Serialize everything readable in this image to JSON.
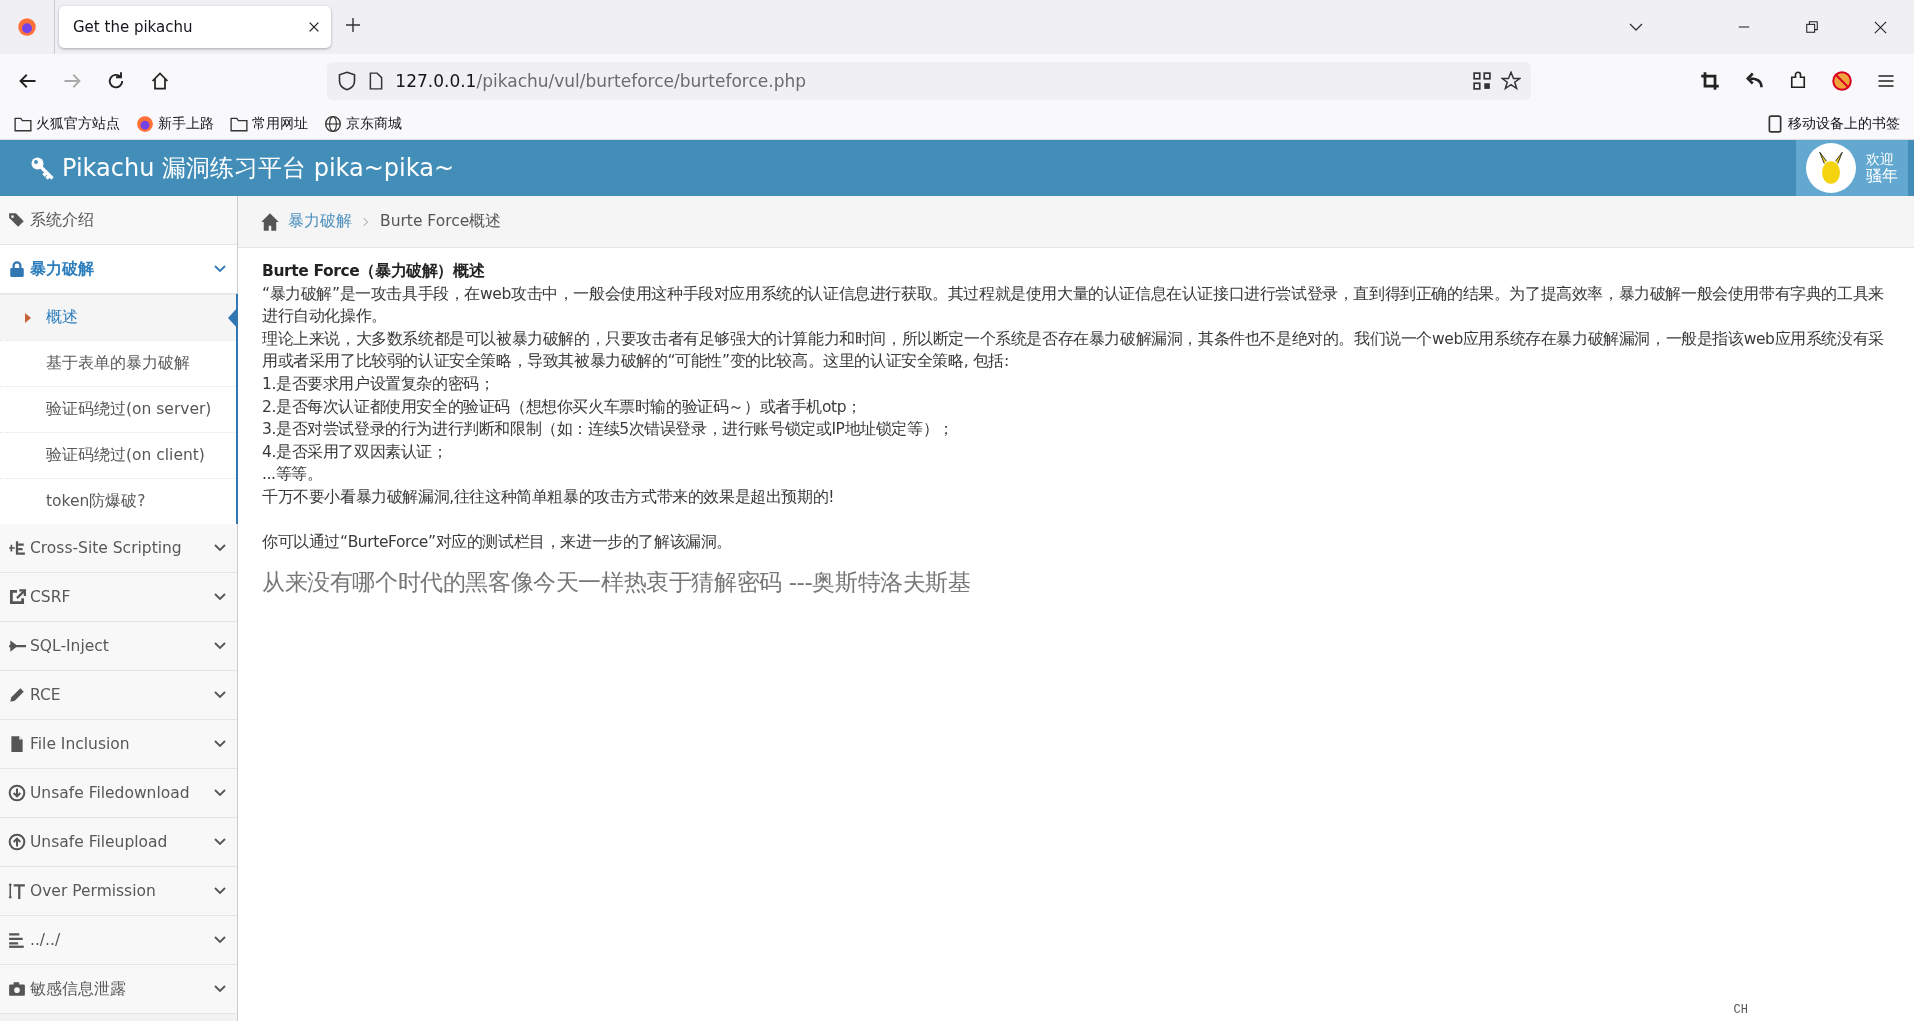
{
  "browser": {
    "tab_title": "Get the pikachu",
    "url_host": "127.0.0.1",
    "url_path": "/pikachu/vul/burteforce/burteforce.php",
    "bookmarks": [
      {
        "label": "火狐官方站点",
        "kind": "folder"
      },
      {
        "label": "新手上路",
        "kind": "firefox"
      },
      {
        "label": "常用网址",
        "kind": "folder"
      },
      {
        "label": "京东商城",
        "kind": "globe"
      }
    ],
    "mobile_bookmarks": "移动设备上的书签"
  },
  "header": {
    "title": "Pikachu 漏洞练习平台 pika~pika~",
    "welcome": "欢迎",
    "user": "骚年"
  },
  "sidebar": {
    "items": [
      {
        "label": "系统介绍",
        "kind": "link"
      },
      {
        "label": "暴力破解",
        "kind": "group",
        "expanded": true,
        "children": [
          {
            "label": "概述",
            "selected": true
          },
          {
            "label": "基于表单的暴力破解",
            "selected": false
          },
          {
            "label": "验证码绕过(on server)",
            "selected": false
          },
          {
            "label": "验证码绕过(on client)",
            "selected": false
          },
          {
            "label": "token防爆破?",
            "selected": false
          }
        ]
      },
      {
        "label": "Cross-Site Scripting",
        "kind": "group",
        "expanded": false
      },
      {
        "label": "CSRF",
        "kind": "group",
        "expanded": false
      },
      {
        "label": "SQL-Inject",
        "kind": "group",
        "expanded": false
      },
      {
        "label": "RCE",
        "kind": "group",
        "expanded": false
      },
      {
        "label": "File Inclusion",
        "kind": "group",
        "expanded": false
      },
      {
        "label": "Unsafe Filedownload",
        "kind": "group",
        "expanded": false
      },
      {
        "label": "Unsafe Fileupload",
        "kind": "group",
        "expanded": false
      },
      {
        "label": "Over Permission",
        "kind": "group",
        "expanded": false
      },
      {
        "label": "../../",
        "kind": "group",
        "expanded": false
      },
      {
        "label": "敏感信息泄露",
        "kind": "group",
        "expanded": false
      }
    ]
  },
  "breadcrumb": {
    "link": "暴力破解",
    "current": "Burte Force概述"
  },
  "content": {
    "heading": "Burte Force（暴力破解）概述",
    "lines": [
      "“暴力破解”是一攻击具手段，在web攻击中，一般会使用这种手段对应用系统的认证信息进行获取。其过程就是使用大量的认证信息在认证接口进行尝试登录，直到得到正确的结果。为了提高效率，暴力破解一般会使用带有字典的工具来进行自动化操作。",
      "理论上来说，大多数系统都是可以被暴力破解的，只要攻击者有足够强大的计算能力和时间，所以断定一个系统是否存在暴力破解漏洞，其条件也不是绝对的。我们说一个web应用系统存在暴力破解漏洞，一般是指该web应用系统没有采用或者采用了比较弱的认证安全策略，导致其被暴力破解的“可能性”变的比较高。这里的认证安全策略, 包括:",
      "1.是否要求用户设置复杂的密码；",
      "2.是否每次认证都使用安全的验证码（想想你买火车票时输的验证码～）或者手机otp；",
      "3.是否对尝试登录的行为进行判断和限制（如：连续5次错误登录，进行账号锁定或IP地址锁定等）；",
      "4.是否采用了双因素认证；",
      "...等等。",
      "千万不要小看暴力破解漏洞,往往这种简单粗暴的攻击方式带来的效果是超出预期的!"
    ],
    "hint": "你可以通过“BurteForce”对应的测试栏目，来进一步的了解该漏洞。",
    "quote": "从来没有哪个时代的黑客像今天一样热衷于猜解密码 ---奥斯特洛夫斯基"
  },
  "ime_indicator": "CH"
}
